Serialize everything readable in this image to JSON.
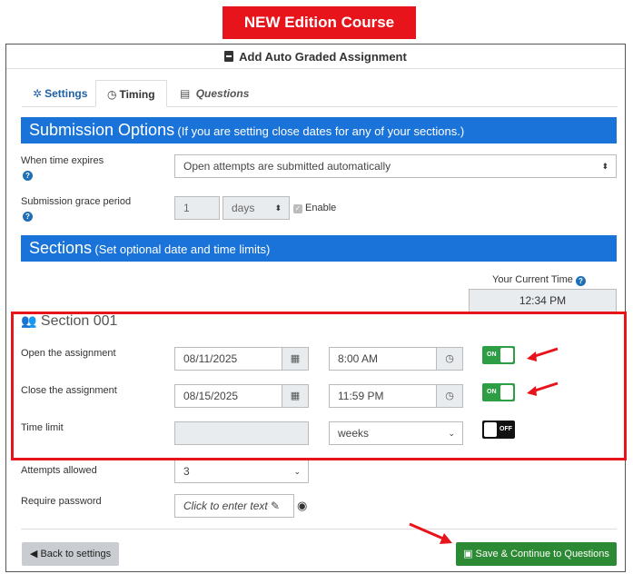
{
  "banner": "NEW Edition Course",
  "header": {
    "title": "Add Auto Graded Assignment",
    "icon": "document-icon"
  },
  "tabs": [
    {
      "label": "Settings",
      "icon": "gear-icon",
      "active": false
    },
    {
      "label": "Timing",
      "icon": "clock-icon",
      "active": true
    },
    {
      "label": "Questions",
      "icon": "list-icon",
      "active": false
    }
  ],
  "submission": {
    "heading": "Submission Options",
    "subheading": "(If you are setting close dates for any of your sections.)",
    "when_expires_label": "When time expires",
    "when_expires_value": "Open attempts are submitted automatically",
    "grace_label": "Submission grace period",
    "grace_value": "1",
    "grace_unit": "days",
    "grace_enable_label": "Enable"
  },
  "sections": {
    "heading": "Sections",
    "subheading": "(Set optional date and time limits)",
    "current_time_label": "Your Current Time",
    "current_time_value": "12:34 PM",
    "section_name": "Section 001",
    "open_label": "Open the assignment",
    "open_date": "08/11/2025",
    "open_time": "8:00 AM",
    "open_toggle": "ON",
    "close_label": "Close the assignment",
    "close_date": "08/15/2025",
    "close_time": "11:59 PM",
    "close_toggle": "ON",
    "time_limit_label": "Time limit",
    "time_limit_value": "",
    "time_limit_unit": "weeks",
    "time_limit_toggle": "OFF",
    "attempts_label": "Attempts allowed",
    "attempts_value": "3",
    "password_label": "Require password",
    "password_placeholder": "Click to enter text"
  },
  "buttons": {
    "back": "Back to settings",
    "save": "Save & Continue to Questions"
  },
  "colors": {
    "banner": "#e8141b",
    "section_bar": "#1a73d9",
    "toggle_on": "#2e9e44",
    "save_button": "#2d8a34",
    "highlight": "#e8141b"
  }
}
